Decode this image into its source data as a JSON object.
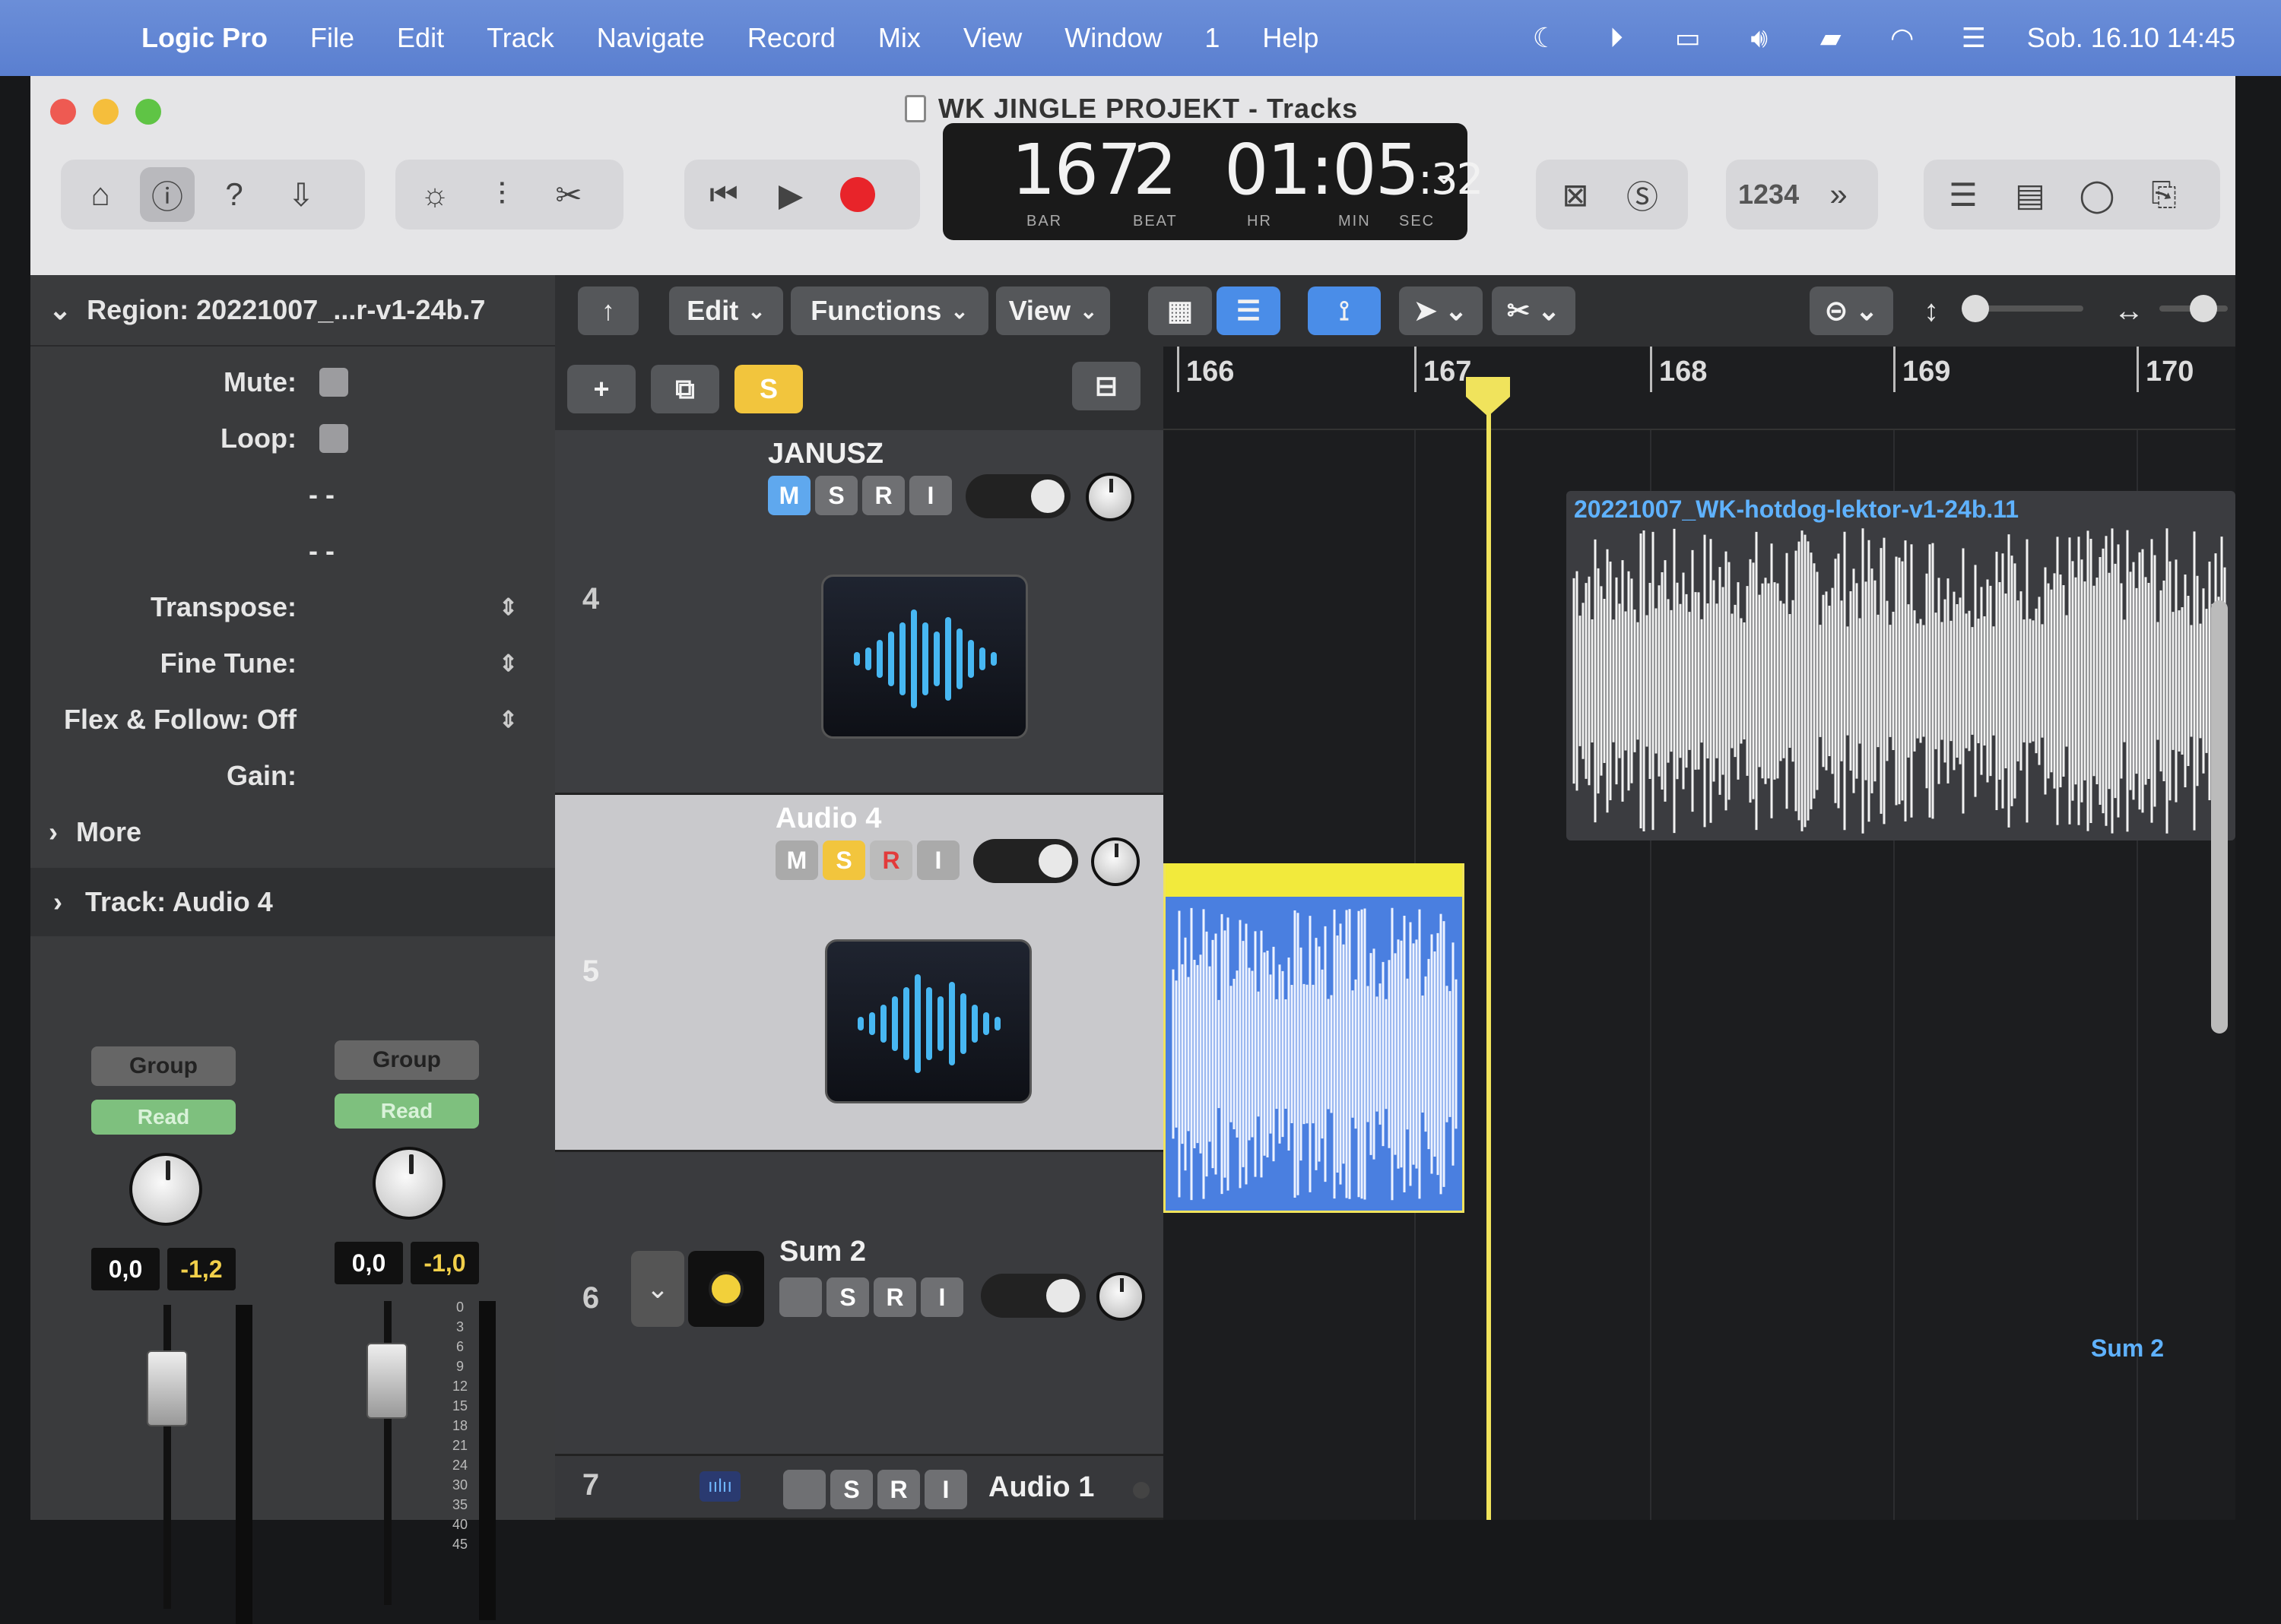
{
  "menubar": {
    "items": [
      "Logic Pro",
      "File",
      "Edit",
      "Track",
      "Navigate",
      "Record",
      "Mix",
      "View",
      "Window",
      "1",
      "Help"
    ],
    "clock": "Sob. 16.10  14:45",
    "bg": "#5a7fd0"
  },
  "window": {
    "title": "WK JINGLE PROJEKT - Tracks"
  },
  "lcd": {
    "bar": "167",
    "beat": "2",
    "time_main": "01:05",
    "time_sec": ":32",
    "labels": [
      "BAR",
      "BEAT",
      "HR",
      "MIN",
      "SEC"
    ]
  },
  "toolbar": {
    "counter": "1234"
  },
  "inspector": {
    "region_title": "Region: 20221007_...r-v1-24b.7",
    "mute_label": "Mute:",
    "loop_label": "Loop:",
    "dash1": "- -",
    "dash2": "- -",
    "transpose_label": "Transpose:",
    "finetune_label": "Fine Tune:",
    "flex_label": "Flex & Follow: Off",
    "gain_label": "Gain:",
    "more_label": "More",
    "track_label": "Track:  Audio 4",
    "strips": [
      {
        "group": "Group",
        "automation": "Read",
        "vol": "0,0",
        "peak": "-1,2"
      },
      {
        "group": "Group",
        "automation": "Read",
        "vol": "0,0",
        "peak": "-1,0"
      }
    ],
    "scale": [
      "0",
      "3",
      "6",
      "9",
      "12",
      "15",
      "18",
      "21",
      "24",
      "30",
      "35",
      "40",
      "45"
    ]
  },
  "trackbar": {
    "edit": "Edit",
    "functions": "Functions",
    "view": "View",
    "solo_badge": "S"
  },
  "ruler": {
    "bars": [
      "166",
      "167",
      "168",
      "169",
      "170"
    ]
  },
  "tracks": [
    {
      "num": "4",
      "name": "JANUSZ"
    },
    {
      "num": "5",
      "name": "Audio 4"
    },
    {
      "num": "6",
      "name": "Sum 2"
    },
    {
      "num": "7",
      "name": "Audio 1"
    }
  ],
  "msri": {
    "m": "M",
    "s": "S",
    "r": "R",
    "i": "I"
  },
  "regions": {
    "lektor": "20221007_WK-hotdog-lektor-v1-24b.11",
    "sum2": "Sum 2"
  },
  "colors": {
    "accent_blue": "#5fa8ee",
    "solo_yellow": "#f2c53d",
    "record_red": "#e8242a",
    "playhead": "#f0e35c",
    "region_blue": "#4a7fe0",
    "read_green": "#7ec07e"
  }
}
